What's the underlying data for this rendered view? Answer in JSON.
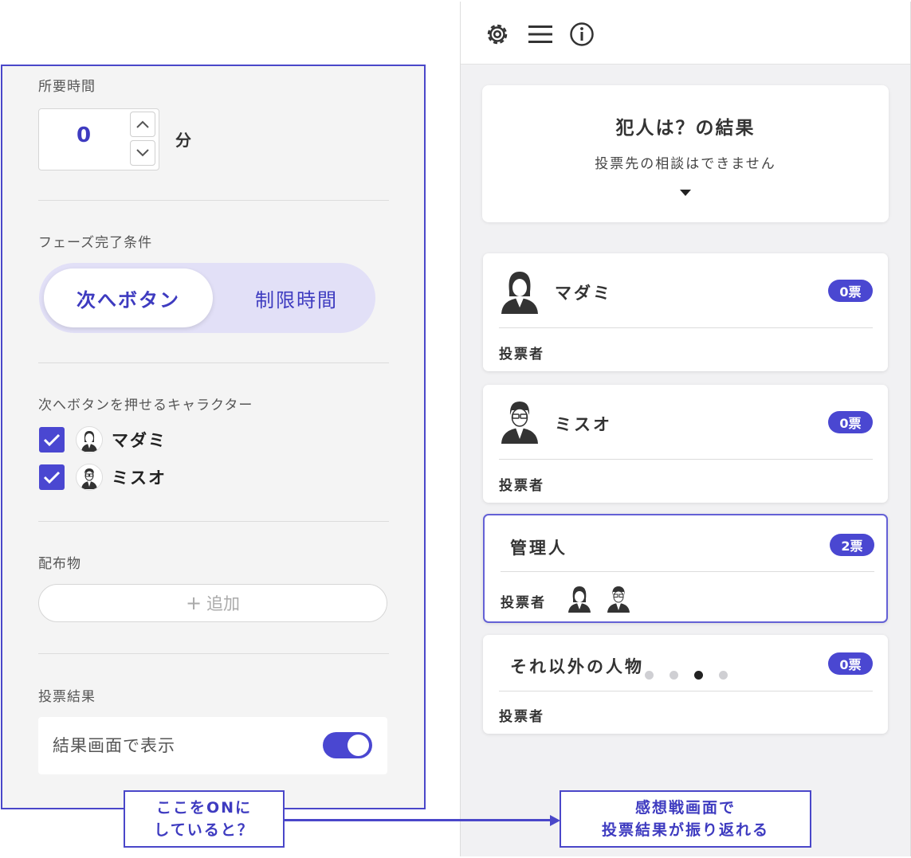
{
  "settings": {
    "duration_label": "所要時間",
    "duration_value": "0",
    "duration_unit": "分",
    "phase_label": "フェーズ完了条件",
    "phase_options": [
      "次へボタン",
      "制限時間"
    ],
    "phase_selected": "次へボタン",
    "next_button_label": "次へボタンを押せるキャラクター",
    "characters": [
      {
        "name": "マダミ",
        "checked": true
      },
      {
        "name": "ミスオ",
        "checked": true
      }
    ],
    "handout_label": "配布物",
    "add_label": "追加",
    "vote_result_label": "投票結果",
    "show_on_result_label": "結果画面で表示",
    "show_on_result_on": true
  },
  "phone": {
    "header_icons": [
      "gear-icon",
      "menu-icon",
      "info-icon"
    ],
    "result_title": "犯人は？の結果",
    "result_subtitle": "投票先の相談はできません",
    "voters_label": "投票者",
    "cards": [
      {
        "name": "マダミ",
        "votes": "0票",
        "avatar": "female",
        "voters": []
      },
      {
        "name": "ミスオ",
        "votes": "0票",
        "avatar": "male",
        "voters": []
      },
      {
        "name": "管理人",
        "votes": "2票",
        "avatar": "",
        "voters": [
          "female",
          "male"
        ]
      },
      {
        "name": "それ以外の人物",
        "votes": "0票",
        "avatar": "",
        "voters": []
      }
    ],
    "pagination": {
      "total": 4,
      "active": 3
    }
  },
  "callouts": {
    "left": [
      "ここをONに",
      "していると？"
    ],
    "right": [
      "感想戦画面で",
      "投票結果が振り返れる"
    ]
  },
  "colors": {
    "accent": "#4a47d1",
    "segment_bg": "#e2e0f7",
    "panel_bg": "#f4f4f4"
  }
}
